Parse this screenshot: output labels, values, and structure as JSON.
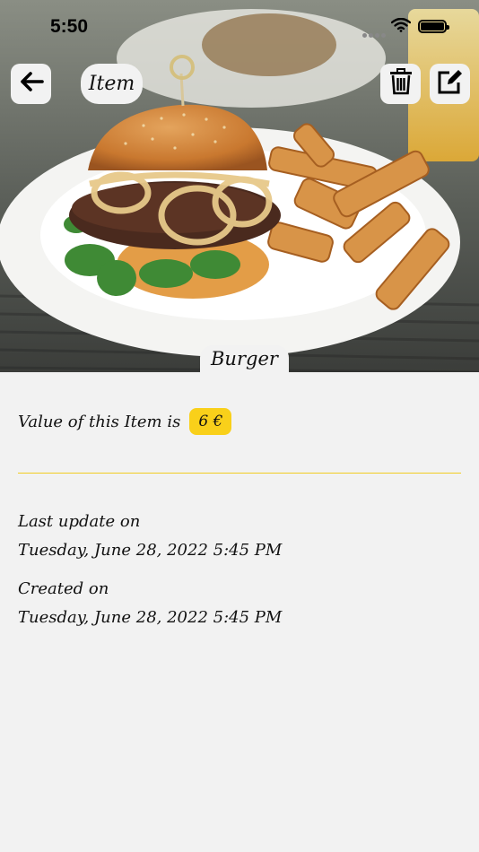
{
  "status_bar": {
    "time": "5:50"
  },
  "nav": {
    "title": "Item"
  },
  "item": {
    "name": "Burger",
    "value_label": "Value of this Item is",
    "value": "6 €",
    "last_update_label": "Last update on",
    "last_update_value": "Tuesday, June 28, 2022 5:45 PM",
    "created_label": "Created on",
    "created_value": "Tuesday, June 28, 2022 5:45 PM"
  },
  "colors": {
    "accent": "#f9d01a",
    "background": "#f2f2f2"
  }
}
